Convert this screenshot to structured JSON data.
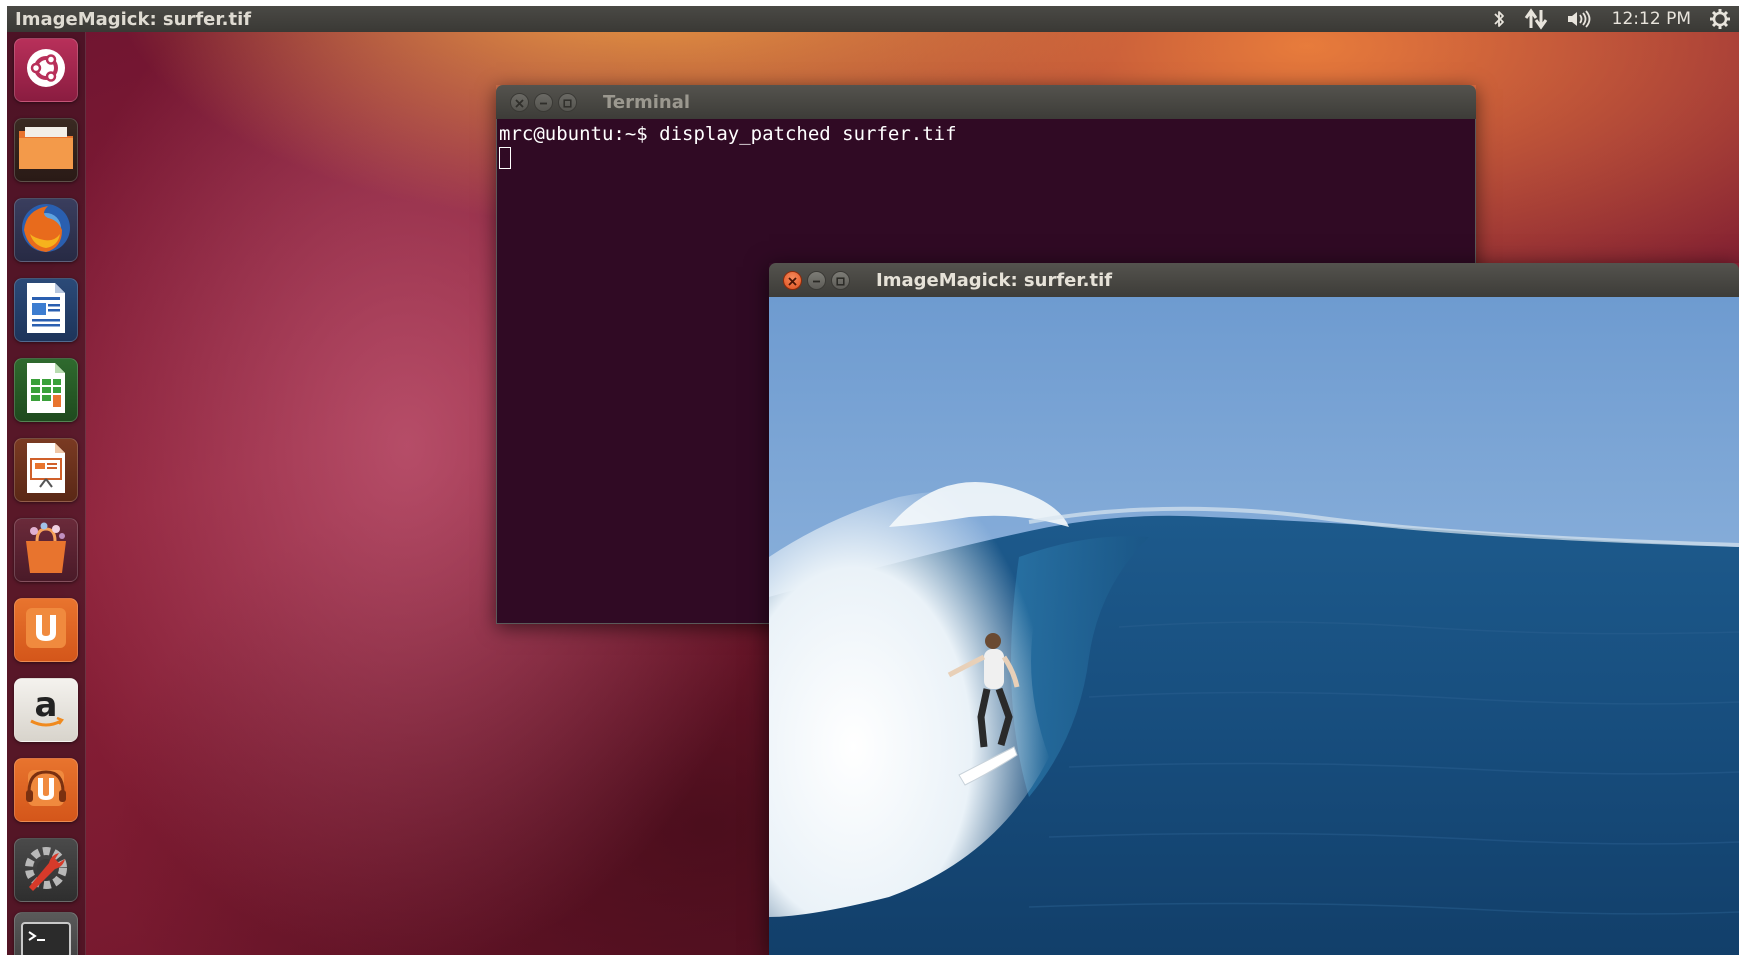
{
  "top_panel": {
    "app_title": "ImageMagick: surfer.tif",
    "indicators": {
      "bluetooth_icon": "bluetooth-icon",
      "network_icon": "network-icon",
      "volume_icon": "volume-icon",
      "session_icon": "gear-icon"
    },
    "clock": "12:12 PM"
  },
  "launcher": {
    "items": [
      {
        "name": "dash-home",
        "icon": "ubuntu-logo-icon"
      },
      {
        "name": "files",
        "icon": "folder-icon"
      },
      {
        "name": "firefox",
        "icon": "firefox-icon"
      },
      {
        "name": "libreoffice-writer",
        "icon": "writer-document-icon"
      },
      {
        "name": "libreoffice-calc",
        "icon": "calc-spreadsheet-icon"
      },
      {
        "name": "libreoffice-impress",
        "icon": "impress-presentation-icon"
      },
      {
        "name": "software-center",
        "icon": "shopping-bag-icon"
      },
      {
        "name": "ubuntu-one",
        "icon": "ubuntu-one-icon"
      },
      {
        "name": "amazon",
        "icon": "amazon-icon"
      },
      {
        "name": "ubuntu-one-music",
        "icon": "music-store-icon"
      },
      {
        "name": "system-settings",
        "icon": "settings-wrench-icon"
      },
      {
        "name": "terminal",
        "icon": "terminal-icon"
      }
    ]
  },
  "terminal": {
    "title": "Terminal",
    "lines": [
      "mrc@ubuntu:~$ display_patched surfer.tif"
    ]
  },
  "imagemagick": {
    "title": "ImageMagick: surfer.tif"
  },
  "colors": {
    "terminal_bg": "#300a24",
    "panel_bg": "#3c3b37",
    "close_button": "#e95420"
  }
}
